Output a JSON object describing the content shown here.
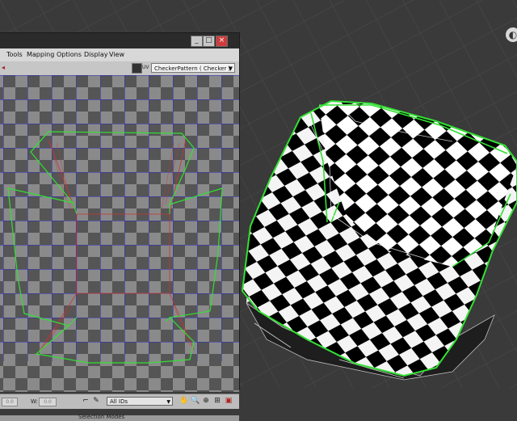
{
  "window": {
    "minimize_glyph": "_",
    "maximize_glyph": "□",
    "close_glyph": "×"
  },
  "menu": {
    "items": [
      "Tools",
      "Mapping",
      "Options",
      "Display",
      "View"
    ]
  },
  "toolbar": {
    "uv_label": "UV",
    "texture_select": "CheckerPattern  ( Checker )"
  },
  "bottom_bar": {
    "w_label": "W:",
    "u_value": "0.0",
    "w_value": "0.0",
    "id_filter": "All IDs"
  },
  "selection_modes_label": "Selection Modes",
  "icons": {
    "viewport_nav": "navigation-wheel-icon",
    "texture_icon": "checker-texture-icon",
    "hand": "pan-hand-icon",
    "zoom": "zoom-icon"
  },
  "colors": {
    "wireframe_green": "#33e033",
    "uv_grid_blue": "#2b2bcc",
    "seam_red": "#cc3333",
    "viewport_bg": "#3a3a3a"
  }
}
